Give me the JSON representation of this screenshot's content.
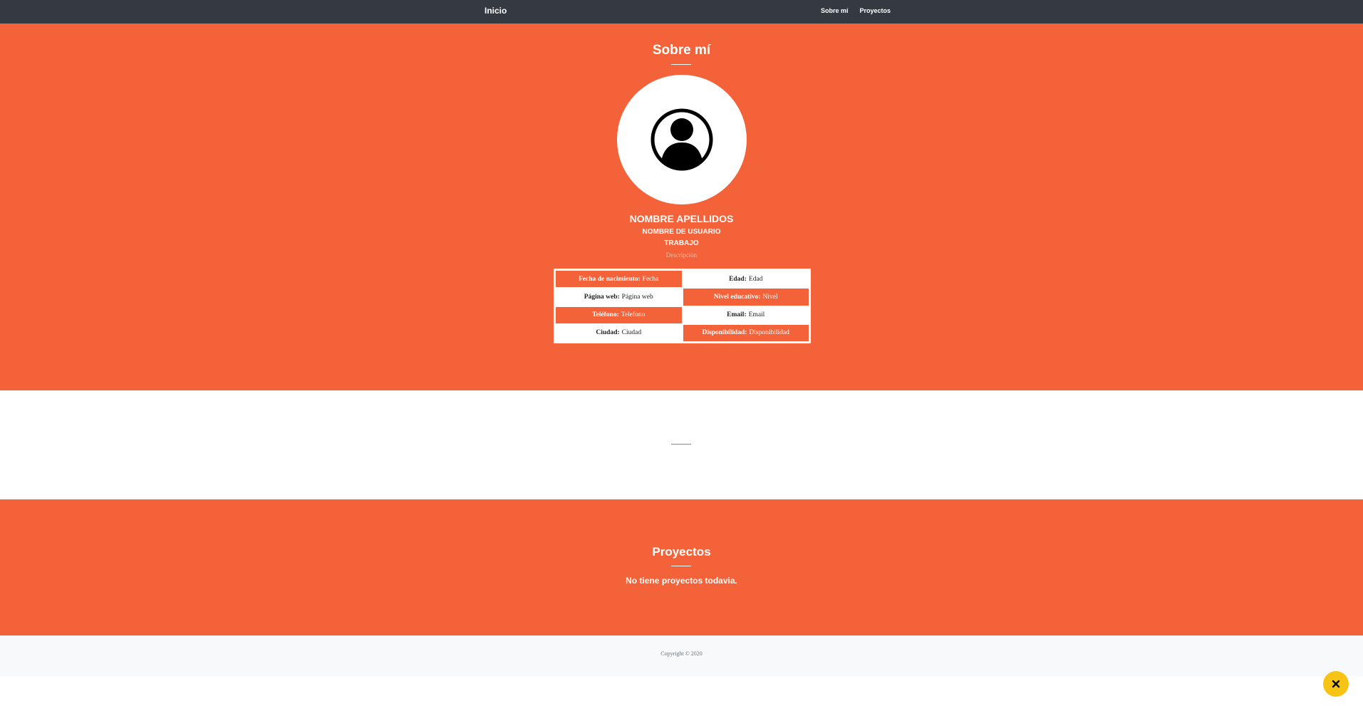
{
  "navbar": {
    "brand": "Inicio",
    "links": [
      "Sobre mí",
      "Proyectos"
    ]
  },
  "about": {
    "title": "Sobre mí",
    "full_name": "NOMBRE APELLIDOS",
    "username": "NOMBRE DE USUARIO",
    "job": "TRABAJO",
    "description": "Descripción",
    "avatar_icon": "user-circle-icon",
    "info": [
      {
        "label": "Fecha de nacimiento:",
        "value": "Fecha",
        "style": "orange"
      },
      {
        "label": "Edad:",
        "value": "Edad",
        "style": "white"
      },
      {
        "label": "Página web:",
        "value": "Página web",
        "style": "white"
      },
      {
        "label": "Nivel educativo:",
        "value": "Nivel",
        "style": "orange"
      },
      {
        "label": "Teléfono:",
        "value": "Telefono",
        "style": "orange"
      },
      {
        "label": "Email:",
        "value": "Email",
        "style": "white"
      },
      {
        "label": "Ciudad:",
        "value": "Ciudad",
        "style": "white"
      },
      {
        "label": "Disponibilidad:",
        "value": "Disponibilidad",
        "style": "orange"
      }
    ]
  },
  "projects": {
    "title": "Proyectos",
    "empty_message": "No tiene proyectos todavia."
  },
  "footer": {
    "copyright": "Copyright © 2020"
  },
  "fab": {
    "icon": "close-icon"
  },
  "colors": {
    "accent": "#f4623a",
    "navbar": "#343a40",
    "fab": "#f7c415",
    "footer_bg": "#f8f9fa"
  }
}
